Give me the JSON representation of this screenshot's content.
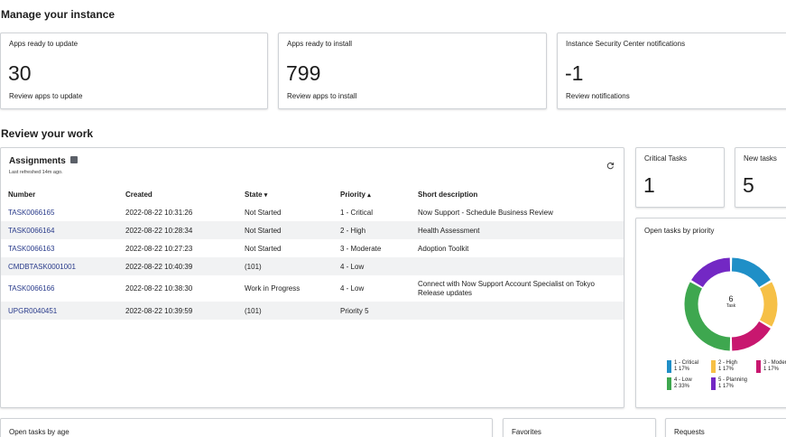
{
  "sections": {
    "manage_title": "Manage your instance",
    "review_title": "Review your work"
  },
  "manage_cards": [
    {
      "title": "Apps ready to update",
      "value": "30",
      "link": "Review apps to update"
    },
    {
      "title": "Apps ready to install",
      "value": "799",
      "link": "Review apps to install"
    },
    {
      "title": "Instance Security Center notifications",
      "value": "-1",
      "link": "Review notifications"
    }
  ],
  "assignments": {
    "title": "Assignments",
    "refreshed": "Last refreshed 14m ago.",
    "columns": [
      "Number",
      "Created",
      "State",
      "Priority",
      "Short description"
    ],
    "state_sort": "▾",
    "priority_sort": "▴",
    "rows": [
      {
        "number": "TASK0066165",
        "created": "2022-08-22 10:31:26",
        "state": "Not Started",
        "priority": "1 - Critical",
        "desc": "Now Support - Schedule Business Review"
      },
      {
        "number": "TASK0066164",
        "created": "2022-08-22 10:28:34",
        "state": "Not Started",
        "priority": "2 - High",
        "desc": "Health Assessment"
      },
      {
        "number": "TASK0066163",
        "created": "2022-08-22 10:27:23",
        "state": "Not Started",
        "priority": "3 - Moderate",
        "desc": "Adoption Toolkit"
      },
      {
        "number": "CMDBTASK0001001",
        "created": "2022-08-22 10:40:39",
        "state": "(101)",
        "priority": "4 - Low",
        "desc": ""
      },
      {
        "number": "TASK0066166",
        "created": "2022-08-22 10:38:30",
        "state": "Work in Progress",
        "priority": "4 - Low",
        "desc": "Connect with Now Support Account Specialist on Tokyo Release updates"
      },
      {
        "number": "UPGR0040451",
        "created": "2022-08-22 10:39:59",
        "state": "(101)",
        "priority": "Priority 5",
        "desc": ""
      }
    ]
  },
  "stat_cards": [
    {
      "title": "Critical Tasks",
      "value": "1"
    },
    {
      "title": "New tasks",
      "value": "5"
    }
  ],
  "priority_chart": {
    "title": "Open tasks by priority",
    "center_value": "6",
    "center_label": "Task"
  },
  "chart_data": {
    "type": "pie",
    "title": "Open tasks by priority",
    "center_value": 6,
    "center_label": "Task",
    "slices": [
      {
        "label": "1 - Critical",
        "count": 1,
        "percent": "17%",
        "value": 1,
        "color": "#1f8fc7"
      },
      {
        "label": "2 - High",
        "count": 1,
        "percent": "17%",
        "value": 1,
        "color": "#f6c046"
      },
      {
        "label": "3 - Moder",
        "count": 1,
        "percent": "17%",
        "value": 1,
        "color": "#c8176f"
      },
      {
        "label": "4 - Low",
        "count": 2,
        "percent": "33%",
        "value": 2,
        "color": "#3ea74f"
      },
      {
        "label": "5 - Planning",
        "count": 1,
        "percent": "17%",
        "value": 1,
        "color": "#7328c4"
      }
    ]
  },
  "bottom_cards": [
    "Open tasks by age",
    "Favorites",
    "Requests"
  ],
  "colors": {
    "link": "#283a8a",
    "border": "#cfd2d6",
    "row_alt": "#f1f2f3"
  }
}
